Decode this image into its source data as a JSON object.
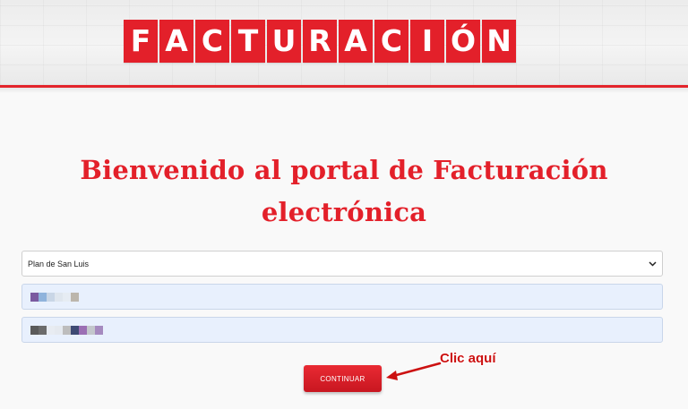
{
  "header": {
    "brand_letters": [
      "F",
      "A",
      "C",
      "T",
      "U",
      "R",
      "A",
      "C",
      "I",
      "Ó",
      "N"
    ],
    "accent_color": "#e3202a"
  },
  "main": {
    "title_line1": "Bienvenido al portal de Facturación",
    "title_line2": "electrónica"
  },
  "form": {
    "branch_select": {
      "selected": "Plan de San Luis"
    },
    "field1_colors": [
      "#7a5aa0",
      "#8fb3dc",
      "#c9d6e6",
      "#dfe6ee",
      "#e6ecf3",
      "#bcb6ac"
    ],
    "field2_colors": [
      "#5a5a5a",
      "#6b6b6b",
      "#e8ecf2",
      "#e5e9ef",
      "#bdbdbd",
      "#3e4a74",
      "#9b6fb4",
      "#c3c7cc",
      "#a58abf"
    ]
  },
  "actions": {
    "continue_label": "CONTINUAR"
  },
  "annotation": {
    "callout_text": "Clic aquí"
  }
}
